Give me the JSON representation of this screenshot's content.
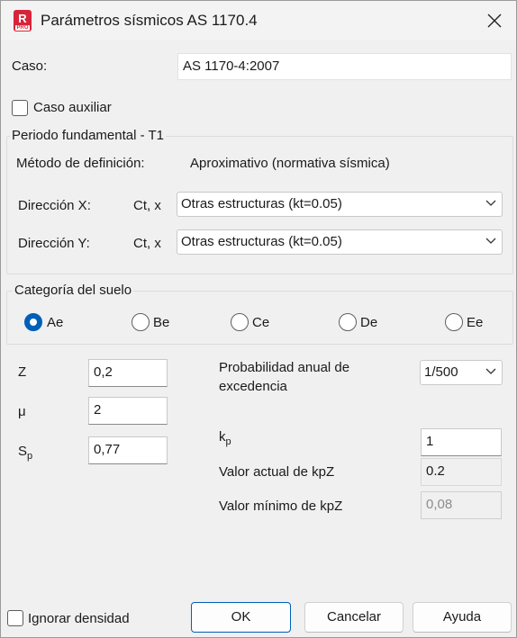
{
  "window": {
    "title": "Parámetros sísmicos AS 1170.4",
    "app_icon_letter": "R",
    "app_icon_badge": "PRO"
  },
  "caso": {
    "label": "Caso:",
    "value": "AS 1170-4:2007"
  },
  "caso_auxiliar": {
    "label": "Caso auxiliar",
    "checked": false
  },
  "periodo": {
    "title": "Periodo fundamental - T1",
    "metodo_label": "Método de definición:",
    "metodo_value": "Aproximativo (normativa sísmica)",
    "dir_x": {
      "label": "Dirección X:",
      "ct": "Ct, x",
      "value": "Otras estructuras (kt=0.05)"
    },
    "dir_y": {
      "label": "Dirección Y:",
      "ct": "Ct, x",
      "value": "Otras estructuras (kt=0.05)"
    }
  },
  "suelo": {
    "title": "Categoría del suelo",
    "options": [
      "Ae",
      "Be",
      "Ce",
      "De",
      "Ee"
    ],
    "selected": "Ae"
  },
  "params": {
    "z": {
      "label": "Z",
      "value": "0,2"
    },
    "mu": {
      "label": "μ",
      "value": "2"
    },
    "sp": {
      "label": "S",
      "sub": "p",
      "value": "0,77"
    },
    "probabilidad": {
      "label": "Probabilidad anual de excedencia",
      "value": "1/500"
    },
    "kp": {
      "label": "k",
      "sub": "p",
      "value": "1"
    },
    "valor_actual": {
      "label": "Valor actual de kpZ",
      "value": "0.2"
    },
    "valor_minimo": {
      "label": "Valor mínimo de kpZ",
      "value": "0,08"
    }
  },
  "footer": {
    "ignorar_densidad": {
      "label": "Ignorar densidad",
      "checked": false
    },
    "ok": "OK",
    "cancelar": "Cancelar",
    "ayuda": "Ayuda"
  },
  "colors": {
    "accent": "#005fb8",
    "app_icon": "#d8243a"
  }
}
